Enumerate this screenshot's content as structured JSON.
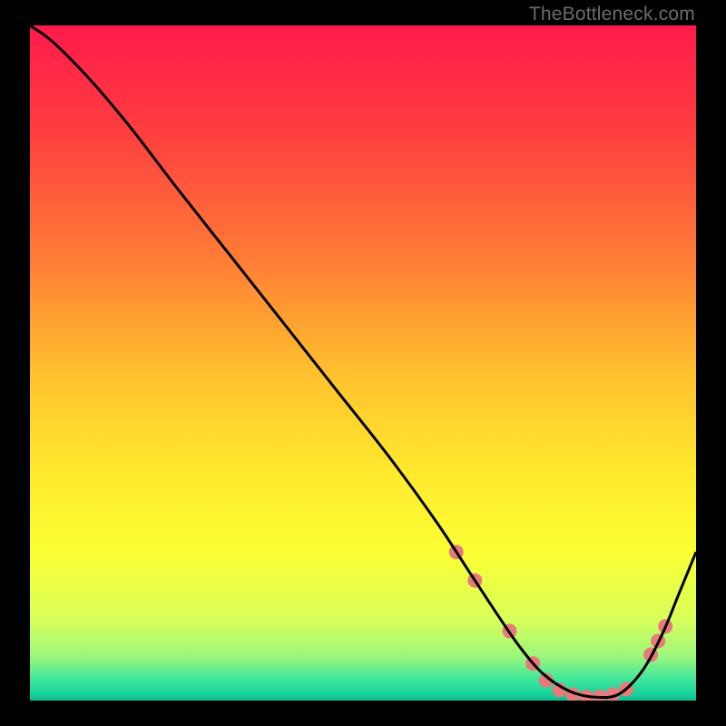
{
  "watermark": "TheBottleneck.com",
  "chart_data": {
    "type": "line",
    "title": "",
    "xlabel": "",
    "ylabel": "",
    "xlim": [
      0,
      100
    ],
    "ylim": [
      0,
      100
    ],
    "gradient_stops": [
      {
        "offset": 0,
        "color": "#ff1a4b"
      },
      {
        "offset": 0.16,
        "color": "#ff3f3f"
      },
      {
        "offset": 0.34,
        "color": "#ff7a36"
      },
      {
        "offset": 0.52,
        "color": "#ffc22e"
      },
      {
        "offset": 0.66,
        "color": "#ffe92e"
      },
      {
        "offset": 0.78,
        "color": "#fbff33"
      },
      {
        "offset": 0.88,
        "color": "#d8ff5a"
      },
      {
        "offset": 0.935,
        "color": "#9cf77c"
      },
      {
        "offset": 0.965,
        "color": "#48e89a"
      },
      {
        "offset": 0.99,
        "color": "#17d39c"
      },
      {
        "offset": 1.0,
        "color": "#0fb88c"
      }
    ],
    "series": [
      {
        "name": "bottleneck-curve",
        "color": "#000000",
        "width": 3,
        "x": [
          0.0,
          3.5,
          9.0,
          15.0,
          22.0,
          30.0,
          38.0,
          46.0,
          54.0,
          61.0,
          66.0,
          70.0,
          73.5,
          77.0,
          81.0,
          85.0,
          88.5,
          92.0,
          95.0,
          97.5,
          100.0
        ],
        "y": [
          100.0,
          97.5,
          92.0,
          85.0,
          76.0,
          66.0,
          56.0,
          46.0,
          36.0,
          26.5,
          19.0,
          13.0,
          8.0,
          4.0,
          1.4,
          0.5,
          1.0,
          4.5,
          10.0,
          16.0,
          22.0
        ]
      }
    ],
    "markers": {
      "color": "#e77a7a",
      "radius": 8,
      "points": [
        {
          "x": 64.0,
          "y": 22.0
        },
        {
          "x": 66.8,
          "y": 17.8
        },
        {
          "x": 72.0,
          "y": 10.3
        },
        {
          "x": 75.5,
          "y": 5.5
        },
        {
          "x": 77.5,
          "y": 3.0
        },
        {
          "x": 79.5,
          "y": 1.6
        },
        {
          "x": 81.5,
          "y": 0.9
        },
        {
          "x": 83.5,
          "y": 0.55
        },
        {
          "x": 85.5,
          "y": 0.55
        },
        {
          "x": 87.5,
          "y": 0.9
        },
        {
          "x": 89.5,
          "y": 1.7
        },
        {
          "x": 93.2,
          "y": 6.8
        },
        {
          "x": 94.3,
          "y": 8.8
        },
        {
          "x": 95.4,
          "y": 11.0
        }
      ]
    }
  }
}
